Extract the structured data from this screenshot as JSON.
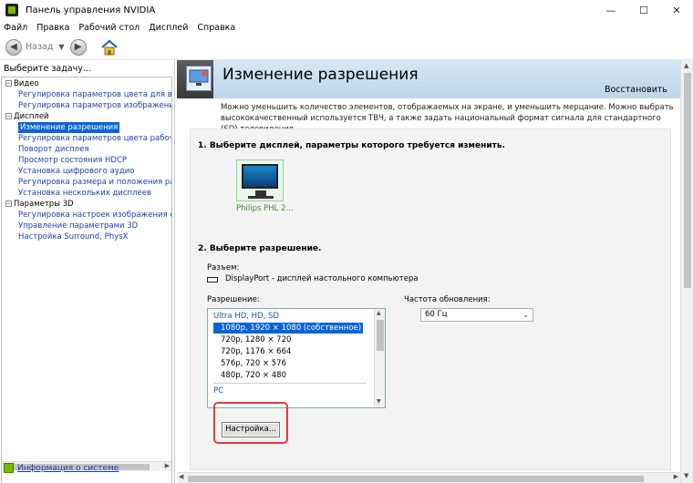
{
  "window": {
    "title": "Панель управления NVIDIA",
    "minimize": "—",
    "maximize": "☐",
    "close": "✕"
  },
  "menu": [
    "Файл",
    "Правка",
    "Рабочий стол",
    "Дисплей",
    "Справка"
  ],
  "toolbar": {
    "back_label": "Назад"
  },
  "left": {
    "task_prompt": "Выберите задачу...",
    "tree": {
      "video": {
        "label": "Видео",
        "items": [
          "Регулировка параметров цвета для вид",
          "Регулировка параметров изображения д"
        ]
      },
      "display": {
        "label": "Дисплей",
        "items": [
          "Изменение разрешения",
          "Регулировка параметров цвета рабочег",
          "Поворот дисплея",
          "Просмотр состояния HDCP",
          "Установка цифрового аудио",
          "Регулировка размера и положения рабо",
          "Установка нескольких дисплеев"
        ]
      },
      "params3d": {
        "label": "Параметры 3D",
        "items": [
          "Регулировка настроек изображения с пр",
          "Управление параметрами 3D",
          "Настройка Surround, PhysX"
        ]
      }
    },
    "system_info": "Информация о системе"
  },
  "main": {
    "title": "Изменение разрешения",
    "restore": "Восстановить",
    "description": "Можно уменьшить количество элементов, отображаемых на экране, и уменьшить мерцание. Можно выбрать высококачественный используется ТВЧ, а также задать национальный формат сигнала для стандартного (SD) телевидения.",
    "step1": "1. Выберите дисплей, параметры которого требуется изменить.",
    "monitor_label": "Philips PHL 2...",
    "step2": "2. Выберите разрешение.",
    "connector_label": "Разъем:",
    "connector_value": "DisplayPort - дисплей настольного компьютера",
    "resolution_label": "Разрешение:",
    "refresh_label": "Частота обновления:",
    "refresh_value": "60 Гц",
    "resolutions": {
      "group1": "Ultra HD, HD, SD",
      "items": [
        "1080p, 1920 × 1080 (собственное)",
        "720p, 1280 × 720",
        "720p, 1176 × 664",
        "576p, 720 × 576",
        "480p, 720 × 480"
      ],
      "group2": "PC"
    },
    "customize_button": "Настройка..."
  }
}
